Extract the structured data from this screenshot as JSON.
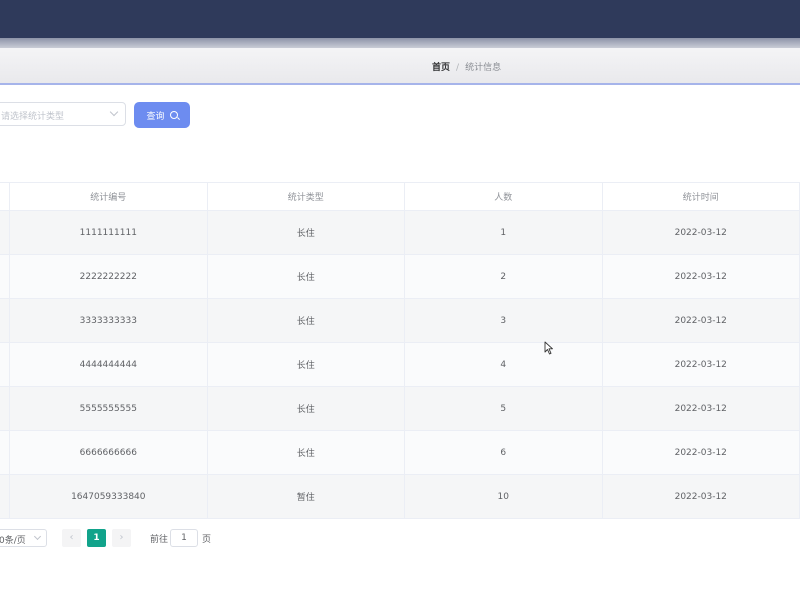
{
  "breadcrumb": {
    "home": "首页",
    "separator": "/",
    "current": "统计信息"
  },
  "filter": {
    "select_placeholder": "请选择统计类型",
    "query_label": "查询"
  },
  "table": {
    "headers": [
      "",
      "统计编号",
      "统计类型",
      "人数",
      "统计时间"
    ],
    "rows": [
      {
        "code": "1111111111",
        "type": "长住",
        "count": "1",
        "date": "2022-03-12"
      },
      {
        "code": "2222222222",
        "type": "长住",
        "count": "2",
        "date": "2022-03-12"
      },
      {
        "code": "3333333333",
        "type": "长住",
        "count": "3",
        "date": "2022-03-12"
      },
      {
        "code": "4444444444",
        "type": "长住",
        "count": "4",
        "date": "2022-03-12"
      },
      {
        "code": "5555555555",
        "type": "长住",
        "count": "5",
        "date": "2022-03-12"
      },
      {
        "code": "6666666666",
        "type": "长住",
        "count": "6",
        "date": "2022-03-12"
      },
      {
        "code": "1647059333840",
        "type": "暂住",
        "count": "10",
        "date": "2022-03-12"
      }
    ]
  },
  "pagination": {
    "page_size": "0条/页",
    "prev": "‹",
    "current_page": "1",
    "next": "›",
    "goto_label": "前往",
    "goto_value": "1",
    "goto_suffix": "页"
  },
  "colors": {
    "topbar": "#2f3a5b",
    "primary": "#6d8cf0",
    "active_page": "#11a38b"
  }
}
